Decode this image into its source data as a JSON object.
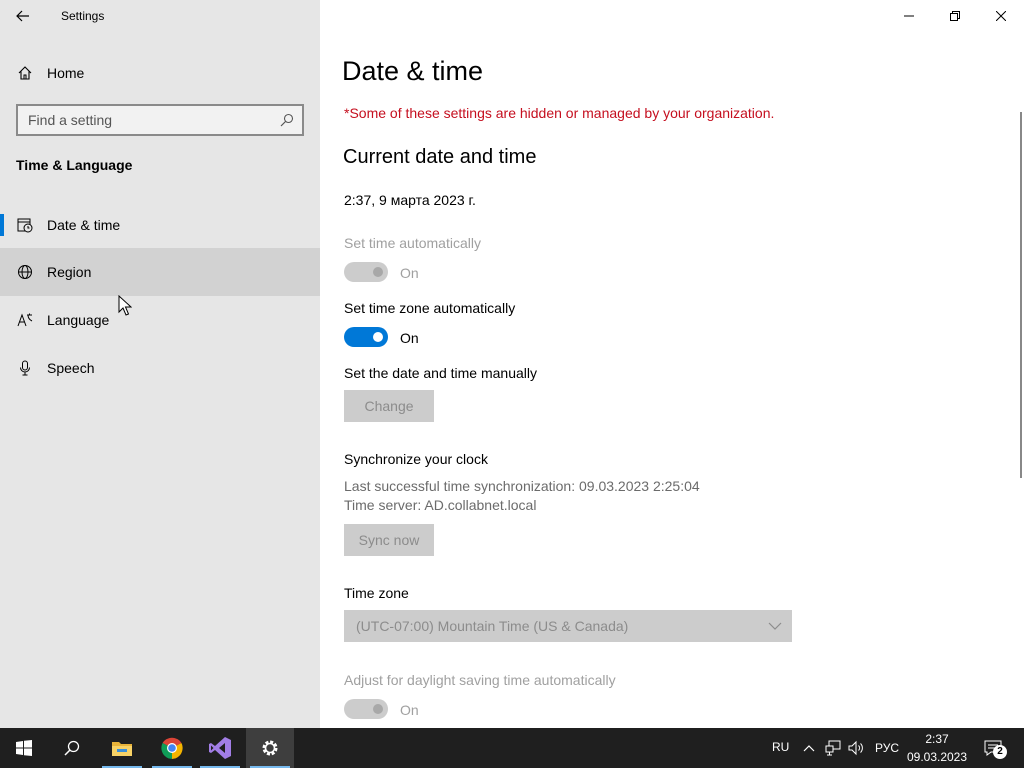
{
  "window": {
    "title": "Settings"
  },
  "sidebar": {
    "home_label": "Home",
    "search": {
      "placeholder": "Find a setting",
      "value": ""
    },
    "section_title": "Time & Language",
    "items": [
      {
        "label": "Date & time",
        "icon": "calendar-clock-icon",
        "selected": true
      },
      {
        "label": "Region",
        "icon": "globe-icon",
        "selected": false
      },
      {
        "label": "Language",
        "icon": "language-icon",
        "selected": false
      },
      {
        "label": "Speech",
        "icon": "microphone-icon",
        "selected": false
      }
    ]
  },
  "main": {
    "page_title": "Date & time",
    "org_warning": "*Some of these settings are hidden or managed by your organization.",
    "current_section_title": "Current date and time",
    "current_datetime": "2:37, 9 марта 2023 г.",
    "set_time_auto": {
      "label": "Set time automatically",
      "state": "On",
      "enabled": false
    },
    "set_tz_auto": {
      "label": "Set time zone automatically",
      "state": "On",
      "enabled": true
    },
    "manual": {
      "label": "Set the date and time manually",
      "button": "Change"
    },
    "sync": {
      "title": "Synchronize your clock",
      "last_sync": "Last successful time synchronization: 09.03.2023 2:25:04",
      "server": "Time server: AD.collabnet.local",
      "button": "Sync now"
    },
    "timezone": {
      "label": "Time zone",
      "value": "(UTC-07:00) Mountain Time (US & Canada)"
    },
    "dst": {
      "label": "Adjust for daylight saving time automatically",
      "state": "On",
      "enabled": false
    }
  },
  "taskbar": {
    "apps": [
      "start-icon",
      "search-icon",
      "file-explorer-icon",
      "chrome-icon",
      "visual-studio-icon",
      "settings-icon"
    ],
    "lang_indicator": "RU",
    "input_lang": "РУС",
    "clock_time": "2:37",
    "clock_date": "09.03.2023",
    "notification_count": "2"
  },
  "colors": {
    "accent": "#0078d7",
    "warning": "#c50f1f",
    "sidebar_bg": "#e6e6e6",
    "taskbar_bg": "#1f1f1f"
  }
}
